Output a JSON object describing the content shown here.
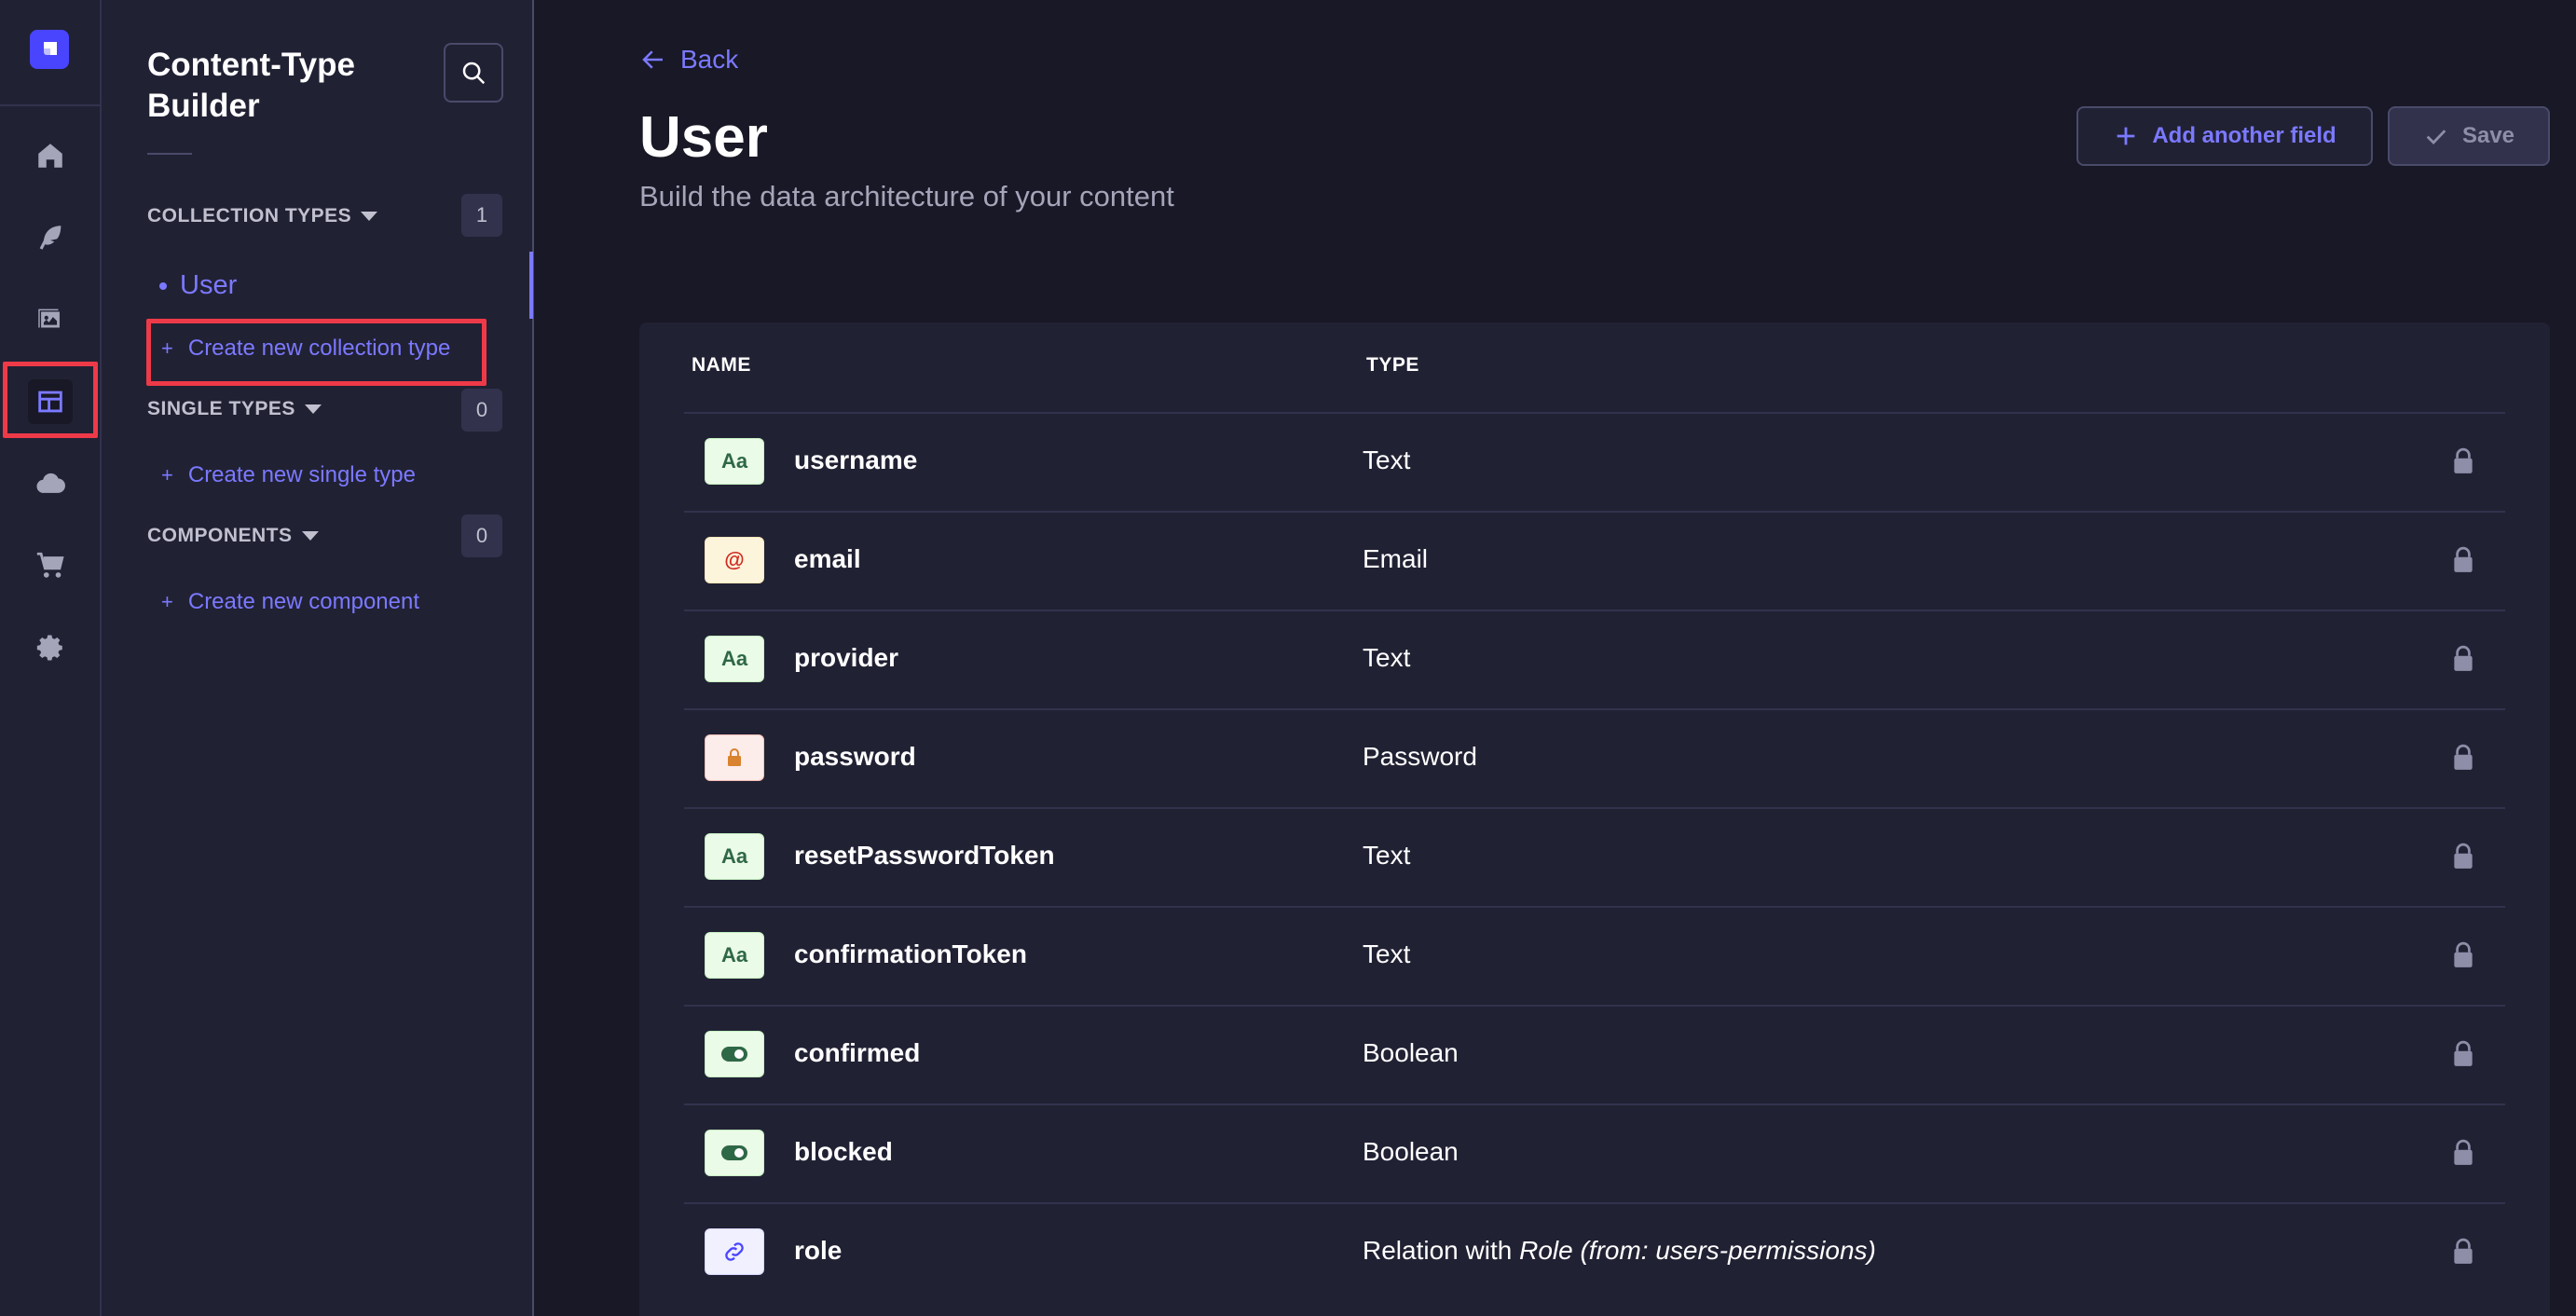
{
  "rail": {
    "items": [
      {
        "name": "home-icon"
      },
      {
        "name": "feather-icon"
      },
      {
        "name": "media-library-icon"
      },
      {
        "name": "layout-icon",
        "active": true
      },
      {
        "name": "cloud-icon"
      },
      {
        "name": "cart-icon"
      },
      {
        "name": "gear-icon"
      }
    ],
    "highlight_color": "#ee3a48"
  },
  "subnav": {
    "title": "Content-Type Builder",
    "collection_types": {
      "label": "COLLECTION TYPES",
      "count": "1",
      "items": [
        "User"
      ],
      "create_label": "Create new collection type"
    },
    "single_types": {
      "label": "SINGLE TYPES",
      "count": "0",
      "create_label": "Create new single type"
    },
    "components": {
      "label": "COMPONENTS",
      "count": "0",
      "create_label": "Create new component"
    }
  },
  "header": {
    "back_label": "Back",
    "title": "User",
    "subtitle": "Build the data architecture of your content",
    "add_field_label": "Add another field",
    "save_label": "Save"
  },
  "table": {
    "columns": [
      "NAME",
      "TYPE"
    ],
    "rows": [
      {
        "name": "username",
        "type": "Text",
        "icon": "text-icon"
      },
      {
        "name": "email",
        "type": "Email",
        "icon": "email-icon"
      },
      {
        "name": "provider",
        "type": "Text",
        "icon": "text-icon"
      },
      {
        "name": "password",
        "type": "Password",
        "icon": "password-icon"
      },
      {
        "name": "resetPasswordToken",
        "type": "Text",
        "icon": "text-icon"
      },
      {
        "name": "confirmationToken",
        "type": "Text",
        "icon": "text-icon"
      },
      {
        "name": "confirmed",
        "type": "Boolean",
        "icon": "boolean-icon"
      },
      {
        "name": "blocked",
        "type": "Boolean",
        "icon": "boolean-icon"
      },
      {
        "name": "role",
        "type_prefix": "Relation with ",
        "type_italic": "Role (from: users-permissions)",
        "icon": "relation-icon"
      }
    ]
  },
  "colors": {
    "accent": "#7b79ff",
    "brand": "#4945ff",
    "background": "#181826",
    "panel": "#212134"
  }
}
